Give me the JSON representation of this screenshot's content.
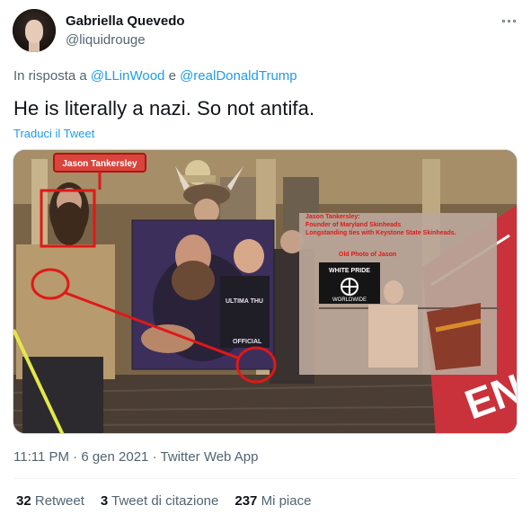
{
  "author": {
    "name": "Gabriella Quevedo",
    "handle": "@liquidrouge"
  },
  "reply": {
    "prefix": "In risposta a",
    "mention1": "@LLinWood",
    "joiner": "e",
    "mention2": "@realDonaldTrump"
  },
  "tweet_text": "He is literally a nazi. So not antifa.",
  "translate_label": "Traduci il Tweet",
  "media": {
    "label_name": "Jason Tankersley",
    "caption_name": "Jason Tankersley:",
    "caption_line2": "Founder of Maryland Skinheads",
    "caption_line3": "Longstanding ties with Keystone State Skinheads.",
    "old_photo_label": "Old Photo of Jason",
    "banner_line1": "WHITE PRIDE",
    "banner_line2": "WORLDWIDE",
    "shirt_text": "ULTIMA THU",
    "shirt_text2": "OFFICIAL",
    "flag_text": "EN"
  },
  "meta": {
    "time": "11:11 PM",
    "date": "6 gen 2021",
    "source": "Twitter Web App"
  },
  "stats": {
    "retweets_count": "32",
    "retweets_label": "Retweet",
    "quotes_count": "3",
    "quotes_label": "Tweet di citazione",
    "likes_count": "237",
    "likes_label": "Mi piace"
  },
  "colors": {
    "accent": "#1d9bf0",
    "annotation_red": "#e01818"
  }
}
